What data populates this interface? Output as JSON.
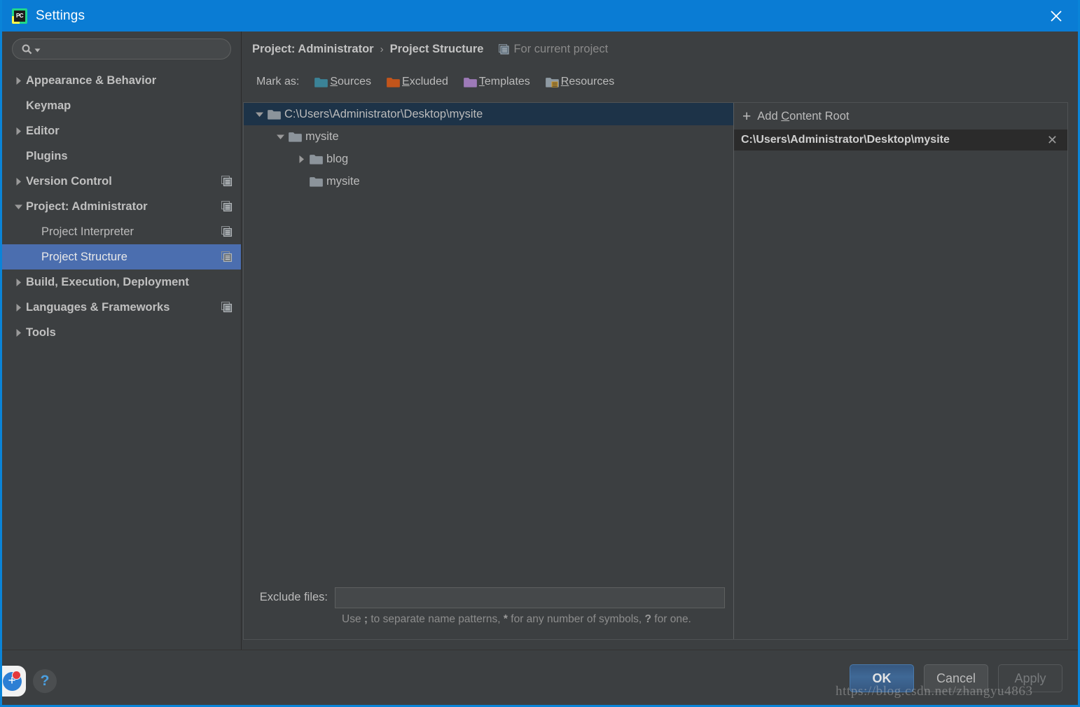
{
  "window": {
    "title": "Settings",
    "logo_text": "PC",
    "close_label": "×"
  },
  "sidebar": {
    "search": {
      "value": "",
      "placeholder": ""
    },
    "items": [
      {
        "label": "Appearance & Behavior",
        "arrow": "collapsed",
        "indent": false,
        "bold": true,
        "scope": false,
        "selected": false
      },
      {
        "label": "Keymap",
        "arrow": "none",
        "indent": false,
        "bold": true,
        "scope": false,
        "selected": false
      },
      {
        "label": "Editor",
        "arrow": "collapsed",
        "indent": false,
        "bold": true,
        "scope": false,
        "selected": false
      },
      {
        "label": "Plugins",
        "arrow": "none",
        "indent": false,
        "bold": true,
        "scope": false,
        "selected": false
      },
      {
        "label": "Version Control",
        "arrow": "collapsed",
        "indent": false,
        "bold": true,
        "scope": true,
        "selected": false
      },
      {
        "label": "Project: Administrator",
        "arrow": "expanded",
        "indent": false,
        "bold": true,
        "scope": true,
        "selected": false
      },
      {
        "label": "Project Interpreter",
        "arrow": "none",
        "indent": true,
        "bold": false,
        "scope": true,
        "selected": false
      },
      {
        "label": "Project Structure",
        "arrow": "none",
        "indent": true,
        "bold": false,
        "scope": true,
        "selected": true
      },
      {
        "label": "Build, Execution, Deployment",
        "arrow": "collapsed",
        "indent": false,
        "bold": true,
        "scope": false,
        "selected": false
      },
      {
        "label": "Languages & Frameworks",
        "arrow": "collapsed",
        "indent": false,
        "bold": true,
        "scope": true,
        "selected": false
      },
      {
        "label": "Tools",
        "arrow": "collapsed",
        "indent": false,
        "bold": true,
        "scope": false,
        "selected": false
      }
    ]
  },
  "main": {
    "breadcrumb": {
      "parent": "Project: Administrator",
      "separator": "›",
      "current": "Project Structure",
      "scope_label": "For current project"
    },
    "mark_as": {
      "label": "Mark as:",
      "options": [
        {
          "id": "sources",
          "pre": "",
          "mnemonic": "S",
          "post": "ources",
          "color": "#3b8397"
        },
        {
          "id": "excluded",
          "pre": "",
          "mnemonic": "E",
          "post": "xcluded",
          "color": "#c2551b"
        },
        {
          "id": "templates",
          "pre": "",
          "mnemonic": "T",
          "post": "emplates",
          "color": "#9d7ab8"
        },
        {
          "id": "resources",
          "pre": "",
          "mnemonic": "R",
          "post": "esources",
          "color": "#8e9aa3"
        }
      ]
    },
    "tree": [
      {
        "label": "C:\\Users\\Administrator\\Desktop\\mysite",
        "depth": 0,
        "twist": "expanded",
        "selected": true
      },
      {
        "label": "mysite",
        "depth": 1,
        "twist": "expanded",
        "selected": false
      },
      {
        "label": "blog",
        "depth": 2,
        "twist": "collapsed",
        "selected": false
      },
      {
        "label": "mysite",
        "depth": 2,
        "twist": "none",
        "selected": false
      }
    ],
    "exclude": {
      "label": "Exclude files:",
      "value": "",
      "placeholder": "",
      "hint_1": "Use ",
      "hint_b1": ";",
      "hint_2": " to separate name patterns, ",
      "hint_b2": "*",
      "hint_3": " for any number of symbols, ",
      "hint_b3": "?",
      "hint_4": " for one."
    },
    "content_roots": {
      "add_pre": "Add ",
      "add_mnemonic": "C",
      "add_post": "ontent Root",
      "rows": [
        {
          "path": "C:\\Users\\Administrator\\Desktop\\mysite",
          "close": "✕"
        }
      ]
    }
  },
  "footer": {
    "plugin_icon_glyph": "➕",
    "help_glyph": "?",
    "buttons": [
      {
        "id": "ok",
        "label": "OK",
        "style": "primary"
      },
      {
        "id": "cancel",
        "label": "Cancel",
        "style": "normal"
      },
      {
        "id": "apply",
        "label": "Apply",
        "style": "disabled"
      }
    ]
  },
  "watermark": {
    "text": "https://blog.csdn.net/zhangyu4863"
  },
  "colors": {
    "titlebar": "#0a7cd4",
    "background": "#3c3f41",
    "selection": "#4b6eaf",
    "tree_selection": "#1d3348",
    "text": "#bbbbbb",
    "accent": "#4a9fe0"
  }
}
